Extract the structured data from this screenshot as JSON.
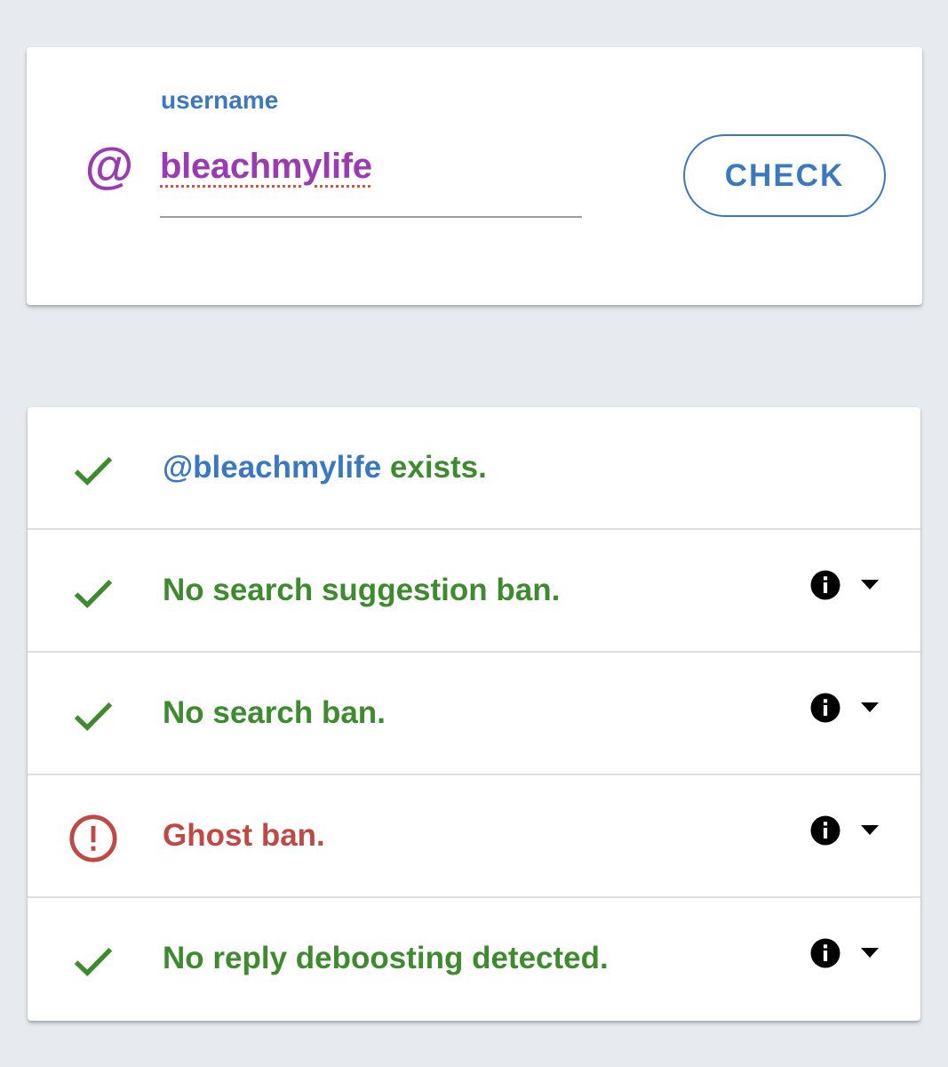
{
  "search": {
    "label": "username",
    "prefix_icon": "at-sign-icon",
    "prefix_symbol": "@",
    "value": "bleachmylife",
    "button_label": "CHECK"
  },
  "results": [
    {
      "status": "ok",
      "icon": "check-icon",
      "handle": "@bleachmylife",
      "text": " exists.",
      "has_details": false
    },
    {
      "status": "ok",
      "icon": "check-icon",
      "text": "No search suggestion ban.",
      "has_details": true
    },
    {
      "status": "ok",
      "icon": "check-icon",
      "text": "No search ban.",
      "has_details": true
    },
    {
      "status": "ban",
      "icon": "alert-circle-icon",
      "text": "Ghost ban.",
      "has_details": true
    },
    {
      "status": "ok",
      "icon": "check-icon",
      "text": "No reply deboosting detected.",
      "has_details": true
    }
  ],
  "colors": {
    "background": "#e7ebef",
    "accent": "#3b78c2",
    "username": "#9b3bb3",
    "ok": "#3d8b2e",
    "ban": "#bf4a45"
  }
}
